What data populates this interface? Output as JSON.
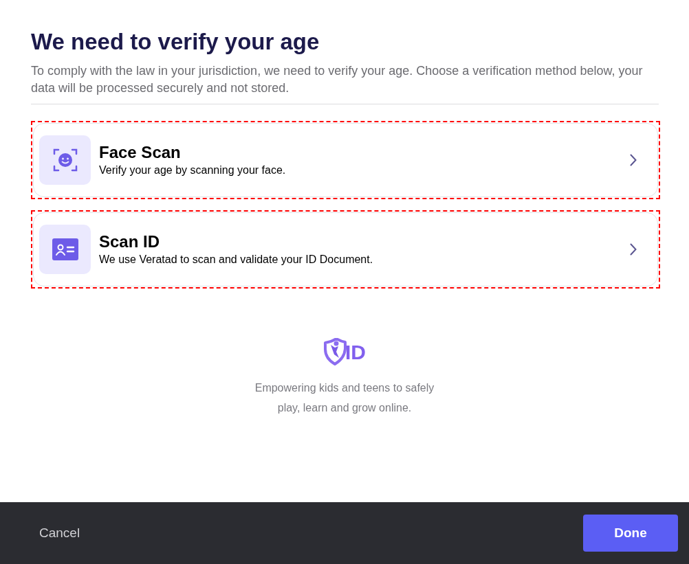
{
  "header": {
    "title": "We need to verify your age",
    "description": "To comply with the law in your jurisdiction, we need to verify your age. Choose a verification method below, your data will be processed securely and not stored."
  },
  "methods": [
    {
      "kind": "face",
      "title": "Face Scan",
      "description": "Verify your age by scanning your face.",
      "highlighted": true
    },
    {
      "kind": "id",
      "title": "Scan ID",
      "description": "We use Veratad to scan and validate your ID Document.",
      "highlighted": true
    }
  ],
  "brand": {
    "logo_text": "ID",
    "tagline_lines": [
      "Empowering kids and teens to safely",
      "play, learn and grow online."
    ]
  },
  "footer": {
    "cancel": "Cancel",
    "done": "Done"
  }
}
